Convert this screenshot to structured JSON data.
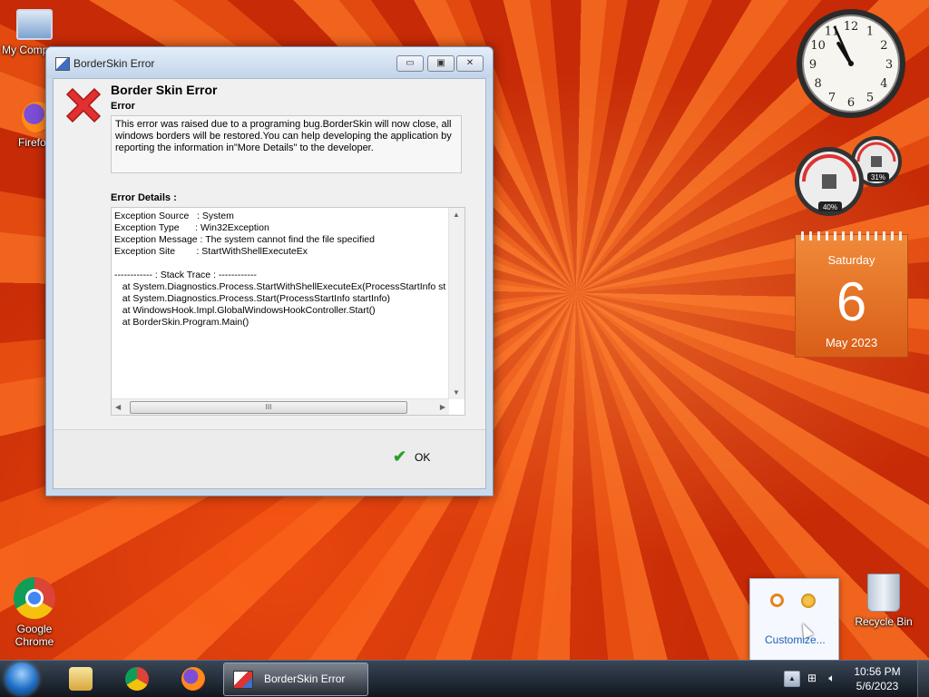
{
  "desktop": {
    "icons": [
      {
        "label": "My Comp"
      },
      {
        "label": "Firefo"
      },
      {
        "label": "Google Chrome"
      },
      {
        "label": "Recycle Bin"
      }
    ]
  },
  "window": {
    "title": "BorderSkin Error",
    "controls": {
      "minimize": "▭",
      "maximize": "▣",
      "close": "✕"
    },
    "heading": "Border Skin Error",
    "error_label": "Error",
    "message": "This error was raised due to a programing bug.BorderSkin will now close, all windows borders will be restored.You can help developing the application by reporting the information in\"More Details\" to the developer.",
    "details_label": "Error Details :",
    "details_text": "Exception Source   : System\nException Type      : Win32Exception\nException Message : The system cannot find the file specified\nException Site        : StartWithShellExecuteEx\n\n------------ : Stack Trace : ------------\n   at System.Diagnostics.Process.StartWithShellExecuteEx(ProcessStartInfo st\n   at System.Diagnostics.Process.Start(ProcessStartInfo startInfo)\n   at WindowsHook.Impl.GlobalWindowsHookController.Start()\n   at BorderSkin.Program.Main()",
    "scroll_thumb_grip": "III",
    "ok_label": "OK"
  },
  "gadgets": {
    "clock": {
      "numbers": [
        "12",
        "1",
        "2",
        "3",
        "4",
        "5",
        "6",
        "7",
        "8",
        "9",
        "10",
        "11"
      ],
      "hour": 10,
      "minute": 56
    },
    "meter": {
      "cpu": "40%",
      "memory": "31%"
    },
    "calendar": {
      "day": "Saturday",
      "date": "6",
      "month_year": "May 2023"
    }
  },
  "tray_popup": {
    "customize_label": "Customize..."
  },
  "taskbar": {
    "active_task": "BorderSkin Error",
    "time": "10:56 PM",
    "date": "5/6/2023",
    "tray_arrow": "▲"
  },
  "colors": {
    "accent": "#1e5fb4",
    "error_red": "#e03030",
    "ok_green": "#2aa12a",
    "calendar": "#e8722a"
  }
}
